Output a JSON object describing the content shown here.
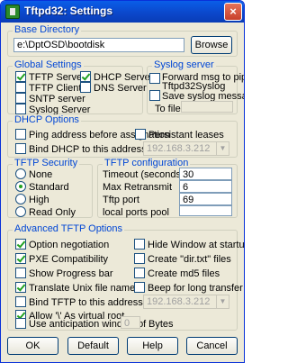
{
  "window": {
    "title": "Tftpd32: Settings",
    "close": "×"
  },
  "base_directory": {
    "label": "Base Directory",
    "value": "e:\\DptOSD\\bootdisk",
    "browse": "Browse"
  },
  "global_settings": {
    "label": "Global Settings",
    "tftp_server": {
      "label": "TFTP Server",
      "checked": true
    },
    "tftp_client": {
      "label": "TFTP Client",
      "checked": false
    },
    "sntp_server": {
      "label": "SNTP server",
      "checked": false
    },
    "syslog_server": {
      "label": "Syslog Server",
      "checked": false
    },
    "dhcp_server": {
      "label": "DHCP Server",
      "checked": true
    },
    "dns_server": {
      "label": "DNS Server",
      "checked": false
    }
  },
  "syslog_group": {
    "label": "Syslog server",
    "forward_line1": "Forward msg to pipe",
    "forward_line2": "Tftpd32Syslog",
    "forward_checked": false,
    "save_label": "Save syslog messages",
    "save_checked": false,
    "to_file": "To file",
    "to_file_value": ""
  },
  "dhcp_options": {
    "label": "DHCP Options",
    "ping": {
      "label": "Ping address before assignation",
      "checked": false
    },
    "persistant": {
      "label": "Persistant leases",
      "checked": false
    },
    "bind": {
      "label": "Bind DHCP to this address",
      "checked": false
    },
    "address": "192.168.3.212"
  },
  "tftp_security": {
    "label": "TFTP Security",
    "options": [
      "None",
      "Standard",
      "High",
      "Read Only"
    ],
    "selected": "Standard"
  },
  "tftp_configuration": {
    "label": "TFTP configuration",
    "timeout_label": "Timeout (seconds)",
    "timeout": "30",
    "retransmit_label": "Max Retransmit",
    "retransmit": "6",
    "port_label": "Tftp port",
    "port": "69",
    "ports_pool_label": "local ports pool",
    "ports_pool": ""
  },
  "advanced": {
    "label": "Advanced TFTP Options",
    "option_negotiation": {
      "label": "Option negotiation",
      "checked": true
    },
    "pxe": {
      "label": "PXE Compatibility",
      "checked": true
    },
    "progress_bar": {
      "label": "Show Progress bar",
      "checked": false
    },
    "translate_unix": {
      "label": "Translate Unix file names",
      "checked": true
    },
    "bind_tftp": {
      "label": "Bind TFTP to this address",
      "checked": false
    },
    "virtual_root": {
      "label": "Allow '\\' As virtual root",
      "checked": true
    },
    "anticipation": {
      "label": "Use anticipation window of",
      "checked": false,
      "value": "0",
      "unit": "Bytes"
    },
    "hide_window": {
      "label": "Hide Window at startup",
      "checked": false
    },
    "dir_txt": {
      "label": "Create \"dir.txt\" files",
      "checked": false
    },
    "md5": {
      "label": "Create md5 files",
      "checked": false
    },
    "beep": {
      "label": "Beep for long transfer",
      "checked": false
    },
    "bind_address": "192.168.3.212"
  },
  "buttons": {
    "ok": "OK",
    "default": "Default",
    "help": "Help",
    "cancel": "Cancel"
  }
}
